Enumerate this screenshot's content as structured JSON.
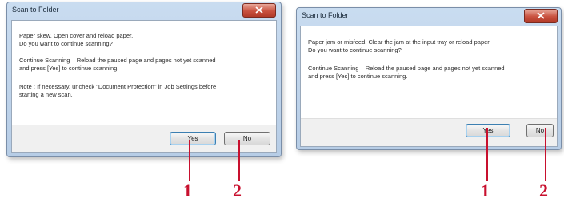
{
  "dialog_left": {
    "title": "Scan to Folder",
    "line1": "Paper skew. Open cover and reload paper.",
    "line2": "Do you want to continue scanning?",
    "line3": "Continue Scanning – Reload the paused page and pages not yet scanned",
    "line4": "and press [Yes] to continue scanning.",
    "line5": "Note : If necessary, uncheck \"Document Protection\" in Job Settings before",
    "line6": "starting a new scan.",
    "yes_label": "Yes",
    "no_label": "No"
  },
  "dialog_right": {
    "title": "Scan to Folder",
    "line1": "Paper jam or misfeed. Clear the jam at the input tray or reload paper.",
    "line2": "Do you want to continue scanning?",
    "line3": "Continue Scanning – Reload the paused page and pages not yet scanned",
    "line4": "and press [Yes] to continue scanning.",
    "yes_label": "Yes",
    "no_label": "No"
  },
  "callouts": {
    "left_yes": "1",
    "left_no": "2",
    "right_yes": "1",
    "right_no": "2",
    "color": "#c8102e"
  }
}
